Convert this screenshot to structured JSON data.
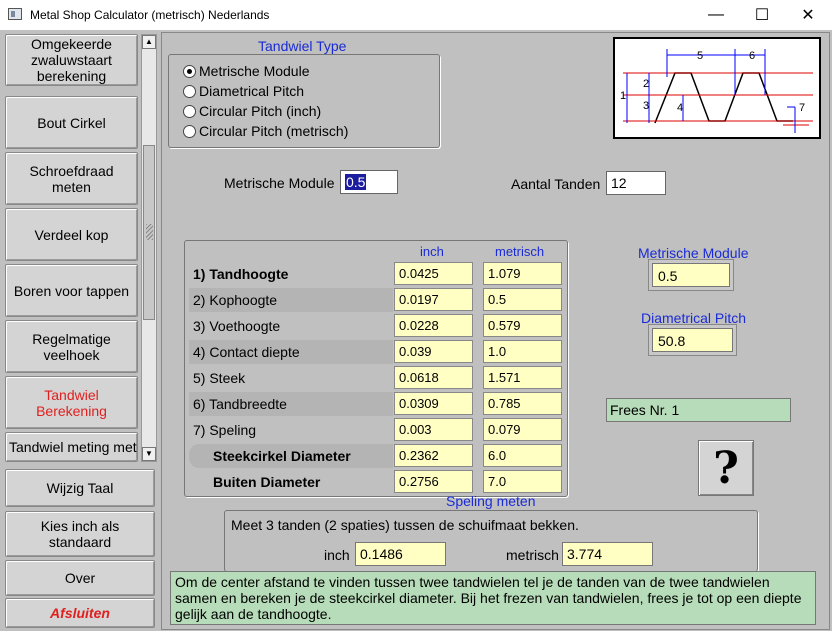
{
  "window": {
    "title": "Metal Shop Calculator (metrisch) Nederlands",
    "minimize": "—",
    "maximize": "☐",
    "close": "✕"
  },
  "sidebar": {
    "items": [
      {
        "label": "Omgekeerde zwaluwstaart berekening"
      },
      {
        "label": "Bout Cirkel"
      },
      {
        "label": "Schroefdraad meten"
      },
      {
        "label": "Verdeel kop"
      },
      {
        "label": "Boren voor tappen"
      },
      {
        "label": "Regelmatige veelhoek"
      },
      {
        "label": "Tandwiel Berekening"
      },
      {
        "label": "Tandwiel meting met"
      }
    ],
    "bottom": {
      "change_language": "Wijzig Taal",
      "inch_default": "Kies inch als standaard",
      "about": "Over",
      "exit": "Afsluiten"
    }
  },
  "gear_type": {
    "title": "Tandwiel Type",
    "options": [
      "Metrische Module",
      "Diametrical Pitch",
      "Circular Pitch (inch)",
      "Circular Pitch (metrisch)"
    ],
    "selected": "Metrische Module"
  },
  "diagram": {
    "labels": [
      "1",
      "2",
      "3",
      "4",
      "5",
      "6",
      "7"
    ]
  },
  "inputs": {
    "module_label": "Metrische Module",
    "module_value": "0.5",
    "teeth_label": "Aantal Tanden",
    "teeth_value": "12"
  },
  "results": {
    "col_inch": "inch",
    "col_metric": "metrisch",
    "rows": [
      {
        "label": "1) Tandhoogte",
        "inch": "0.0425",
        "metric": "1.079"
      },
      {
        "label": "2) Kophoogte",
        "inch": "0.0197",
        "metric": "0.5"
      },
      {
        "label": "3) Voethoogte",
        "inch": "0.0228",
        "metric": "0.579"
      },
      {
        "label": "4) Contact diepte",
        "inch": "0.039",
        "metric": "1.0"
      },
      {
        "label": "5) Steek",
        "inch": "0.0618",
        "metric": "1.571"
      },
      {
        "label": "6) Tandbreedte",
        "inch": "0.0309",
        "metric": "0.785"
      },
      {
        "label": "7) Speling",
        "inch": "0.003",
        "metric": "0.079"
      },
      {
        "label": "Steekcirkel Diameter",
        "inch": "0.2362",
        "metric": "6.0"
      },
      {
        "label": "Buiten Diameter",
        "inch": "0.2756",
        "metric": "7.0"
      }
    ]
  },
  "right_panel": {
    "module_label": "Metrische Module",
    "module_value": "0.5",
    "dp_label": "Diametrical Pitch",
    "dp_value": "50.8",
    "cutter": "Frees Nr. 1",
    "help": "?"
  },
  "clearance": {
    "title": "Speling meten",
    "description": "Meet 3 tanden (2 spaties) tussen de schuifmaat bekken.",
    "inch_label": "inch",
    "inch_value": "0.1486",
    "metric_label": "metrisch",
    "metric_value": "3.774"
  },
  "info_text": "Om de center afstand te vinden tussen twee tandwielen tel je de tanden van de twee tandwielen samen en bereken je de steekcirkel diameter. Bij het frezen van tandwielen, frees je tot op een diepte gelijk aan de tandhoogte."
}
